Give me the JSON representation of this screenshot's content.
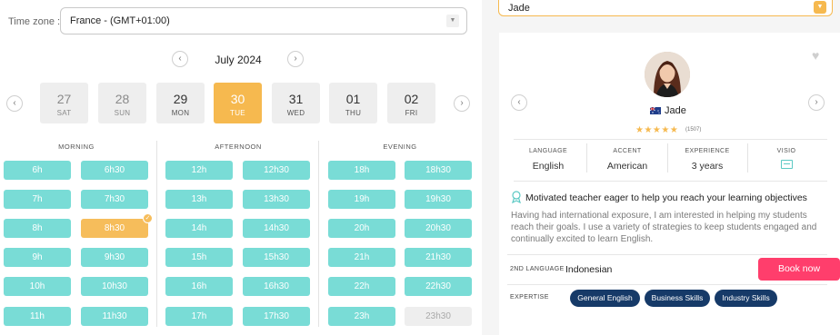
{
  "timezone": {
    "label": "Time zone :",
    "value": "France - (GMT+01:00)"
  },
  "calendar": {
    "month_label": "July 2024",
    "days": [
      {
        "num": "27",
        "dow": "SAT",
        "state": "past"
      },
      {
        "num": "28",
        "dow": "SUN",
        "state": "past"
      },
      {
        "num": "29",
        "dow": "MON",
        "state": "normal"
      },
      {
        "num": "30",
        "dow": "TUE",
        "state": "selected"
      },
      {
        "num": "31",
        "dow": "WED",
        "state": "normal"
      },
      {
        "num": "01",
        "dow": "THU",
        "state": "normal"
      },
      {
        "num": "02",
        "dow": "FRI",
        "state": "normal"
      }
    ]
  },
  "sections": {
    "morning": "MORNING",
    "afternoon": "AFTERNOON",
    "evening": "EVENING"
  },
  "slots": {
    "morning": [
      [
        "6h",
        "6h30"
      ],
      [
        "7h",
        "7h30"
      ],
      [
        "8h",
        "8h30"
      ],
      [
        "9h",
        "9h30"
      ],
      [
        "10h",
        "10h30"
      ],
      [
        "11h",
        "11h30"
      ]
    ],
    "afternoon": [
      [
        "12h",
        "12h30"
      ],
      [
        "13h",
        "13h30"
      ],
      [
        "14h",
        "14h30"
      ],
      [
        "15h",
        "15h30"
      ],
      [
        "16h",
        "16h30"
      ],
      [
        "17h",
        "17h30"
      ]
    ],
    "evening": [
      [
        "18h",
        "18h30"
      ],
      [
        "19h",
        "19h30"
      ],
      [
        "20h",
        "20h30"
      ],
      [
        "21h",
        "21h30"
      ],
      [
        "22h",
        "22h30"
      ],
      [
        "23h",
        "23h30"
      ]
    ],
    "selected": "8h30",
    "disabled": [
      "23h30"
    ]
  },
  "teacher_select": {
    "value": "Jade"
  },
  "teacher": {
    "name": "Jade",
    "stars": "★★★★★",
    "review_count": "(1507)",
    "info": {
      "language_label": "LANGUAGE",
      "language": "English",
      "accent_label": "ACCENT",
      "accent": "American",
      "experience_label": "EXPERIENCE",
      "experience": "3 years",
      "visio_label": "VISIO"
    },
    "motto": "Motivated teacher eager to help you reach your learning objectives",
    "description": "Having had international exposure, I am interested in helping my students reach their goals. I use a variety of strategies to keep students engaged and continually excited to learn English.",
    "second_language_label": "2ND LANGUAGE",
    "second_language": "Indonesian",
    "book_label": "Book now",
    "expertise_label": "EXPERTISE",
    "expertise": [
      "General English",
      "Business Skills",
      "Industry Skills"
    ]
  },
  "colors": {
    "slot": "#79dcd6",
    "selected": "#f6b94f",
    "book": "#ff3e6c",
    "tag": "#163a68"
  }
}
